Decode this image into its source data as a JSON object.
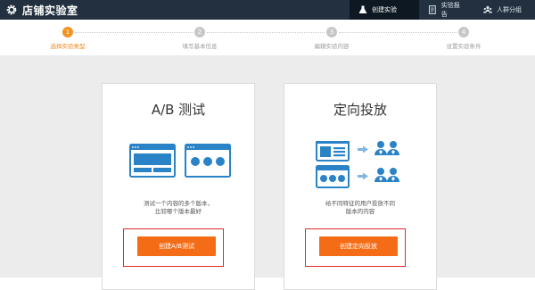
{
  "header": {
    "app_title": "店铺实验室",
    "nav": [
      {
        "label": "创建实验",
        "icon": "flask-icon",
        "active": true
      },
      {
        "label": "实验报告",
        "icon": "report-icon",
        "active": false
      },
      {
        "label": "人群分组",
        "icon": "people-group-icon",
        "active": false
      }
    ]
  },
  "steps": [
    {
      "num": "1",
      "label": "选择实验类型",
      "active": true
    },
    {
      "num": "2",
      "label": "填写基本信息",
      "active": false
    },
    {
      "num": "3",
      "label": "编辑实验内容",
      "active": false
    },
    {
      "num": "4",
      "label": "设置实验条件",
      "active": false
    }
  ],
  "cards": {
    "ab": {
      "title": "A/B 测试",
      "desc_line1": "测试一个内容的多个版本，",
      "desc_line2": "比较哪个版本最好",
      "button": "创建A/B测试"
    },
    "targeted": {
      "title": "定向投放",
      "desc_line1": "给不同特征的用户投放不同",
      "desc_line2": "版本的内容",
      "button": "创建定向投放"
    }
  },
  "colors": {
    "header_bg": "#22303f",
    "accent": "#f46c16",
    "step_active": "#f29320",
    "illustration_blue": "#2a83c6",
    "highlight_border": "#e12a2a"
  }
}
